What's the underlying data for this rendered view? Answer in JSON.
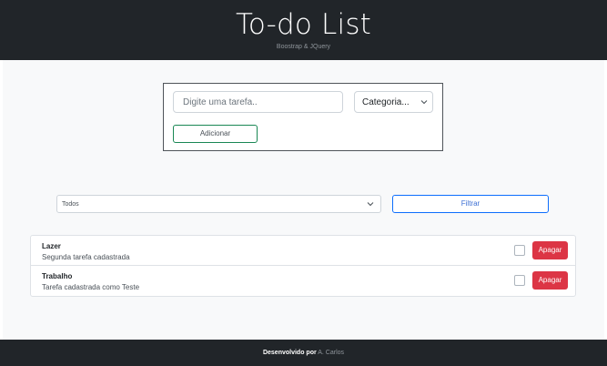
{
  "header": {
    "title": "To-do List",
    "subtitle": "Boostrap & JQuery"
  },
  "form": {
    "task_placeholder": "Digite uma tarefa..",
    "category_selected": "Categoria...",
    "add_label": "Adicionar"
  },
  "filter": {
    "selected": "Todos",
    "button_label": "Filtrar"
  },
  "tasks": [
    {
      "category": "Lazer",
      "description": "Segunda tarefa cadastrada",
      "done": false,
      "delete_label": "Apagar"
    },
    {
      "category": "Trabalho",
      "description": "Tarefa cadastrada como Teste",
      "done": false,
      "delete_label": "Apagar"
    }
  ],
  "footer": {
    "lead": "Desenvolvido por",
    "author": "A. Carlos"
  },
  "colors": {
    "header_bg": "#212529",
    "add_border": "#198754",
    "filter_border": "#0d6efd",
    "delete_bg": "#dc3545"
  }
}
